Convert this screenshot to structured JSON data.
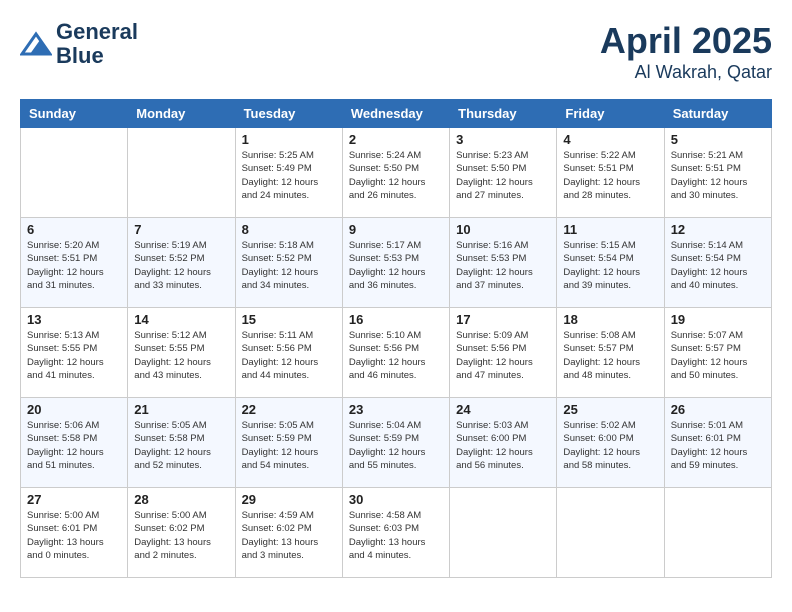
{
  "header": {
    "logo_line1": "General",
    "logo_line2": "Blue",
    "month": "April 2025",
    "location": "Al Wakrah, Qatar"
  },
  "days_of_week": [
    "Sunday",
    "Monday",
    "Tuesday",
    "Wednesday",
    "Thursday",
    "Friday",
    "Saturday"
  ],
  "weeks": [
    [
      {
        "day": "",
        "detail": ""
      },
      {
        "day": "",
        "detail": ""
      },
      {
        "day": "1",
        "detail": "Sunrise: 5:25 AM\nSunset: 5:49 PM\nDaylight: 12 hours\nand 24 minutes."
      },
      {
        "day": "2",
        "detail": "Sunrise: 5:24 AM\nSunset: 5:50 PM\nDaylight: 12 hours\nand 26 minutes."
      },
      {
        "day": "3",
        "detail": "Sunrise: 5:23 AM\nSunset: 5:50 PM\nDaylight: 12 hours\nand 27 minutes."
      },
      {
        "day": "4",
        "detail": "Sunrise: 5:22 AM\nSunset: 5:51 PM\nDaylight: 12 hours\nand 28 minutes."
      },
      {
        "day": "5",
        "detail": "Sunrise: 5:21 AM\nSunset: 5:51 PM\nDaylight: 12 hours\nand 30 minutes."
      }
    ],
    [
      {
        "day": "6",
        "detail": "Sunrise: 5:20 AM\nSunset: 5:51 PM\nDaylight: 12 hours\nand 31 minutes."
      },
      {
        "day": "7",
        "detail": "Sunrise: 5:19 AM\nSunset: 5:52 PM\nDaylight: 12 hours\nand 33 minutes."
      },
      {
        "day": "8",
        "detail": "Sunrise: 5:18 AM\nSunset: 5:52 PM\nDaylight: 12 hours\nand 34 minutes."
      },
      {
        "day": "9",
        "detail": "Sunrise: 5:17 AM\nSunset: 5:53 PM\nDaylight: 12 hours\nand 36 minutes."
      },
      {
        "day": "10",
        "detail": "Sunrise: 5:16 AM\nSunset: 5:53 PM\nDaylight: 12 hours\nand 37 minutes."
      },
      {
        "day": "11",
        "detail": "Sunrise: 5:15 AM\nSunset: 5:54 PM\nDaylight: 12 hours\nand 39 minutes."
      },
      {
        "day": "12",
        "detail": "Sunrise: 5:14 AM\nSunset: 5:54 PM\nDaylight: 12 hours\nand 40 minutes."
      }
    ],
    [
      {
        "day": "13",
        "detail": "Sunrise: 5:13 AM\nSunset: 5:55 PM\nDaylight: 12 hours\nand 41 minutes."
      },
      {
        "day": "14",
        "detail": "Sunrise: 5:12 AM\nSunset: 5:55 PM\nDaylight: 12 hours\nand 43 minutes."
      },
      {
        "day": "15",
        "detail": "Sunrise: 5:11 AM\nSunset: 5:56 PM\nDaylight: 12 hours\nand 44 minutes."
      },
      {
        "day": "16",
        "detail": "Sunrise: 5:10 AM\nSunset: 5:56 PM\nDaylight: 12 hours\nand 46 minutes."
      },
      {
        "day": "17",
        "detail": "Sunrise: 5:09 AM\nSunset: 5:56 PM\nDaylight: 12 hours\nand 47 minutes."
      },
      {
        "day": "18",
        "detail": "Sunrise: 5:08 AM\nSunset: 5:57 PM\nDaylight: 12 hours\nand 48 minutes."
      },
      {
        "day": "19",
        "detail": "Sunrise: 5:07 AM\nSunset: 5:57 PM\nDaylight: 12 hours\nand 50 minutes."
      }
    ],
    [
      {
        "day": "20",
        "detail": "Sunrise: 5:06 AM\nSunset: 5:58 PM\nDaylight: 12 hours\nand 51 minutes."
      },
      {
        "day": "21",
        "detail": "Sunrise: 5:05 AM\nSunset: 5:58 PM\nDaylight: 12 hours\nand 52 minutes."
      },
      {
        "day": "22",
        "detail": "Sunrise: 5:05 AM\nSunset: 5:59 PM\nDaylight: 12 hours\nand 54 minutes."
      },
      {
        "day": "23",
        "detail": "Sunrise: 5:04 AM\nSunset: 5:59 PM\nDaylight: 12 hours\nand 55 minutes."
      },
      {
        "day": "24",
        "detail": "Sunrise: 5:03 AM\nSunset: 6:00 PM\nDaylight: 12 hours\nand 56 minutes."
      },
      {
        "day": "25",
        "detail": "Sunrise: 5:02 AM\nSunset: 6:00 PM\nDaylight: 12 hours\nand 58 minutes."
      },
      {
        "day": "26",
        "detail": "Sunrise: 5:01 AM\nSunset: 6:01 PM\nDaylight: 12 hours\nand 59 minutes."
      }
    ],
    [
      {
        "day": "27",
        "detail": "Sunrise: 5:00 AM\nSunset: 6:01 PM\nDaylight: 13 hours\nand 0 minutes."
      },
      {
        "day": "28",
        "detail": "Sunrise: 5:00 AM\nSunset: 6:02 PM\nDaylight: 13 hours\nand 2 minutes."
      },
      {
        "day": "29",
        "detail": "Sunrise: 4:59 AM\nSunset: 6:02 PM\nDaylight: 13 hours\nand 3 minutes."
      },
      {
        "day": "30",
        "detail": "Sunrise: 4:58 AM\nSunset: 6:03 PM\nDaylight: 13 hours\nand 4 minutes."
      },
      {
        "day": "",
        "detail": ""
      },
      {
        "day": "",
        "detail": ""
      },
      {
        "day": "",
        "detail": ""
      }
    ]
  ]
}
